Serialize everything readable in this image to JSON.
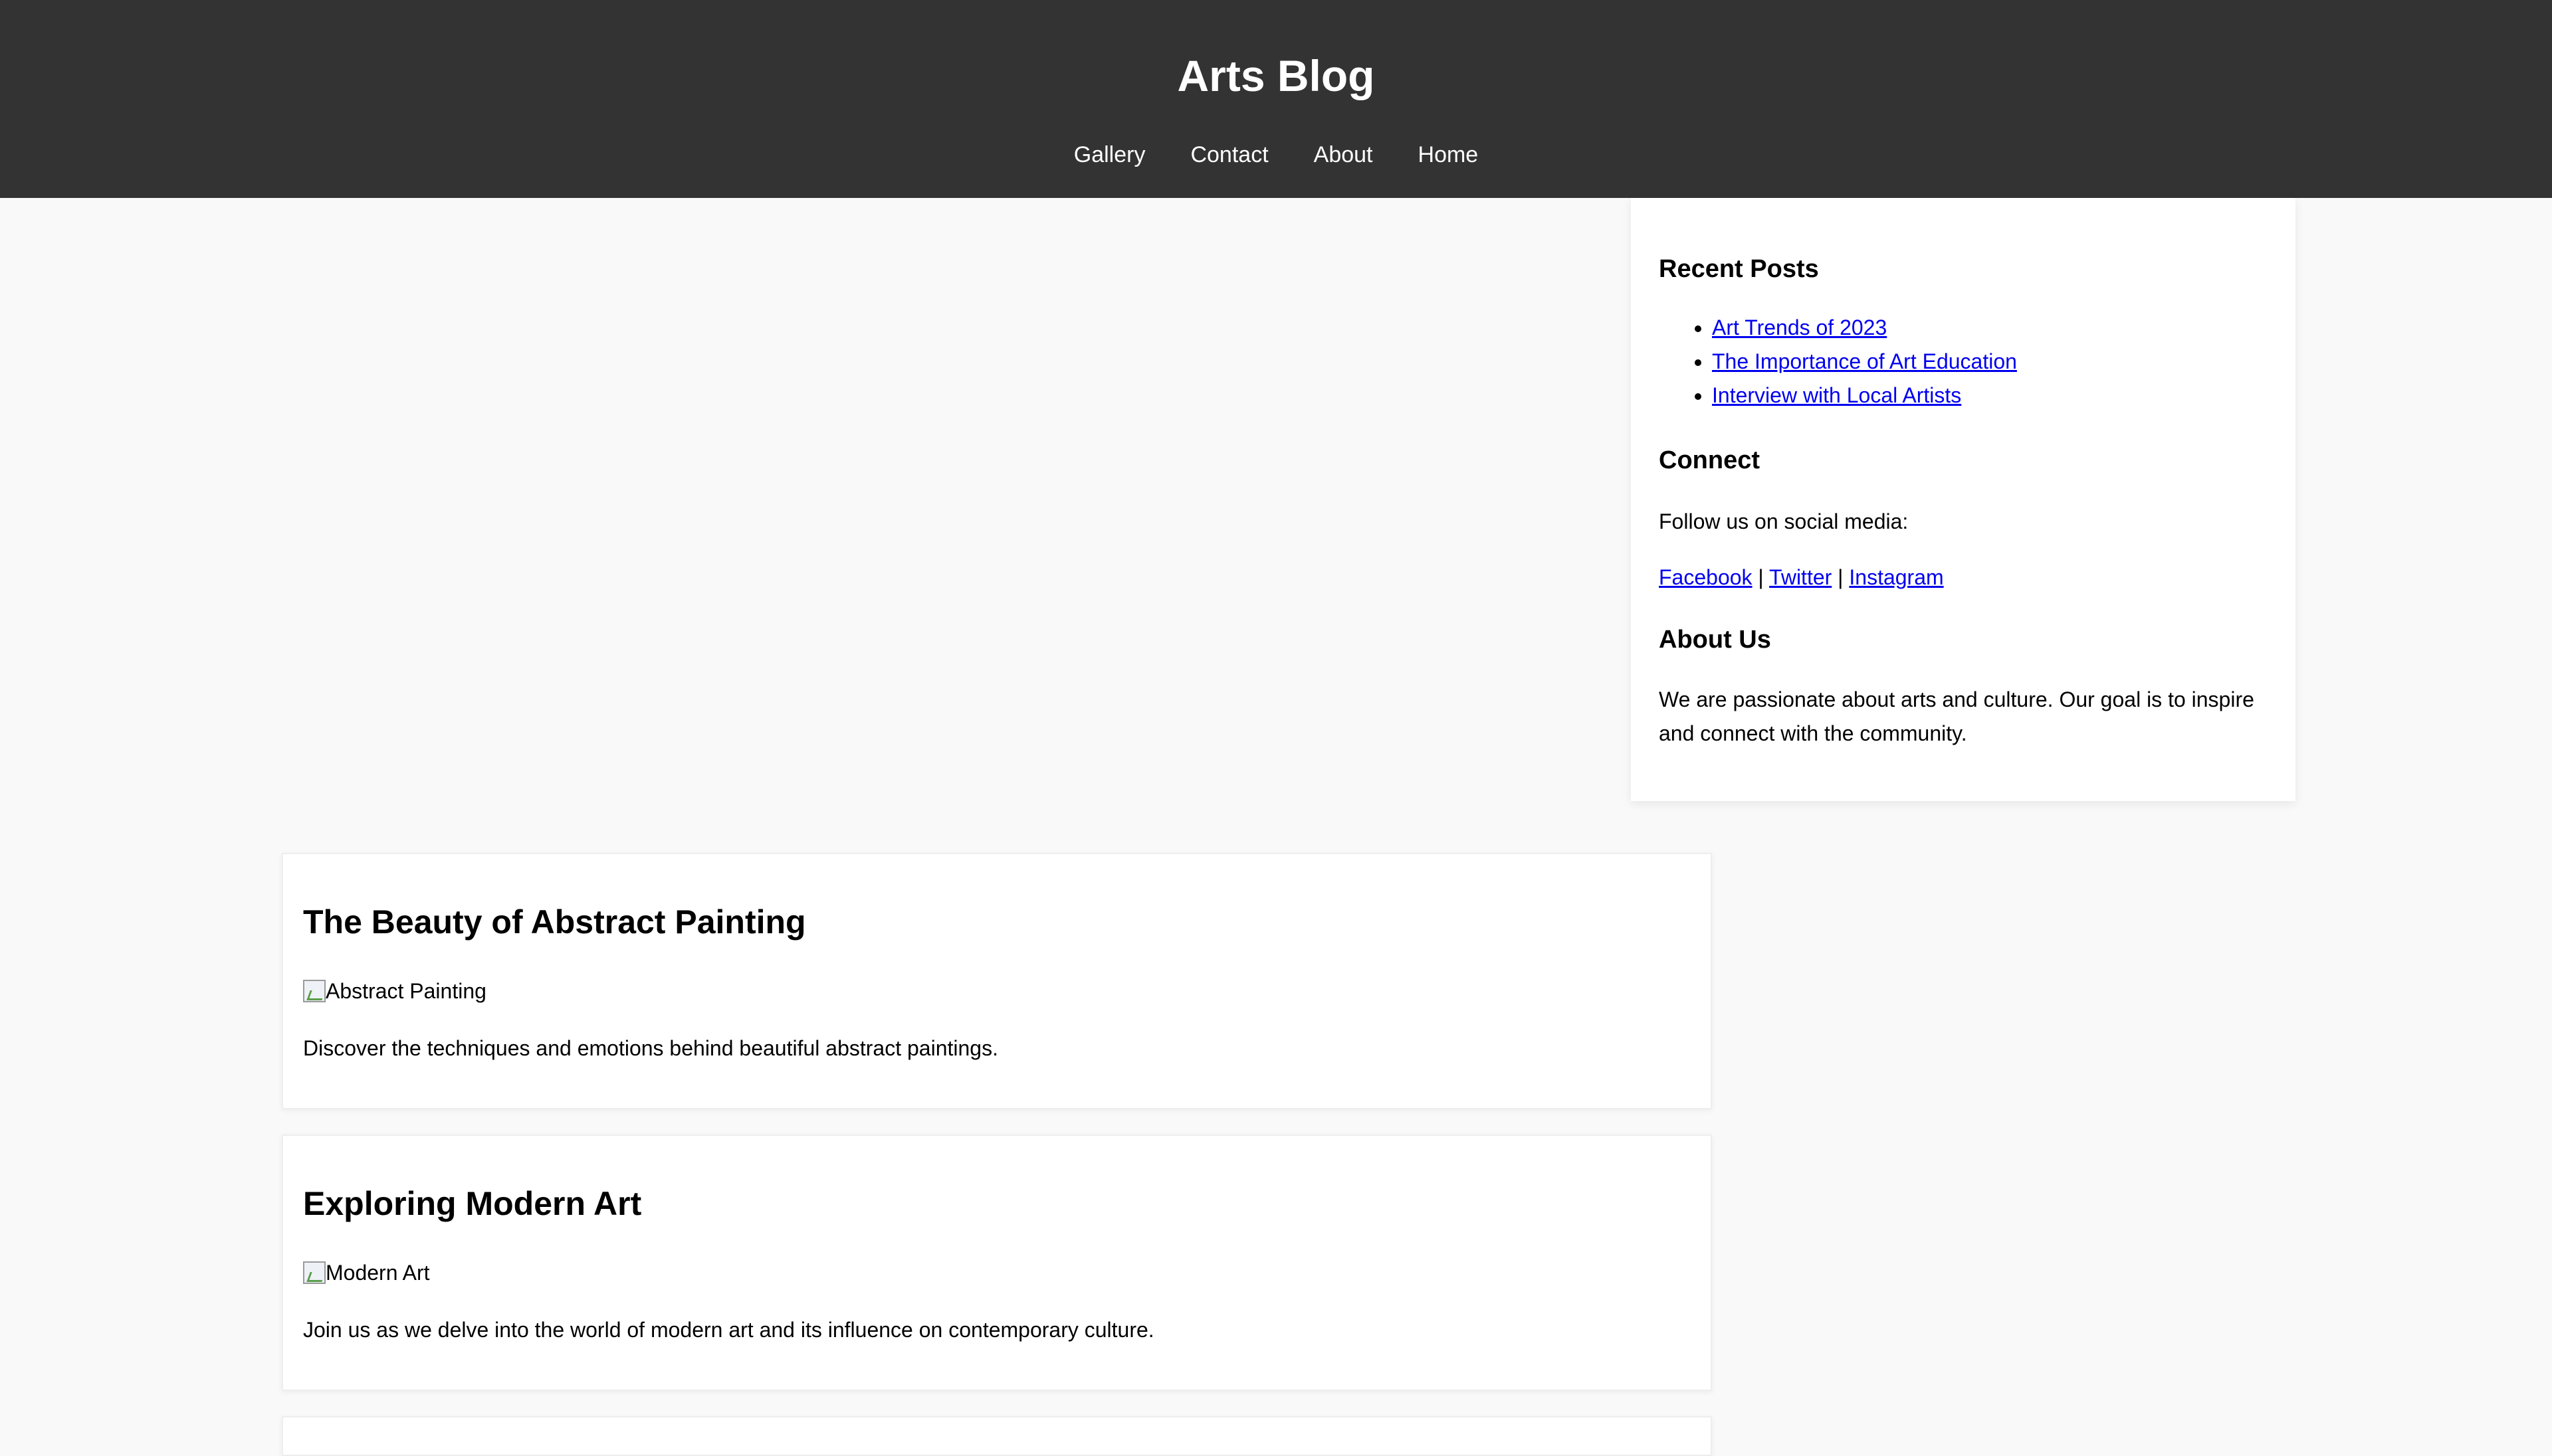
{
  "header": {
    "title": "Arts Blog",
    "nav": [
      {
        "label": "Gallery"
      },
      {
        "label": "Contact"
      },
      {
        "label": "About"
      },
      {
        "label": "Home"
      }
    ]
  },
  "sidebar": {
    "recent_title": "Recent Posts",
    "recent_posts": [
      {
        "label": "Art Trends of 2023"
      },
      {
        "label": "The Importance of Art Education"
      },
      {
        "label": "Interview with Local Artists"
      }
    ],
    "connect_title": "Connect",
    "connect_text": "Follow us on social media:",
    "social": [
      {
        "label": "Facebook"
      },
      {
        "label": "Twitter"
      },
      {
        "label": "Instagram"
      }
    ],
    "separator": "|",
    "about_title": "About Us",
    "about_text": "We are passionate about arts and culture. Our goal is to inspire and connect with the community."
  },
  "posts": [
    {
      "title": "The Beauty of Abstract Painting",
      "image_alt": "Abstract Painting",
      "excerpt": "Discover the techniques and emotions behind beautiful abstract paintings."
    },
    {
      "title": "Exploring Modern Art",
      "image_alt": "Modern Art",
      "excerpt": "Join us as we delve into the world of modern art and its influence on contemporary culture."
    }
  ],
  "colors": {
    "header_bg": "#333333",
    "page_bg": "#f9f9f9",
    "link": "#0000ee"
  }
}
